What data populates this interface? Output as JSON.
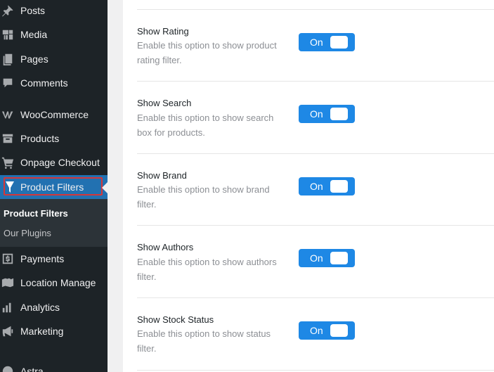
{
  "sidebar": {
    "items": [
      {
        "label": "Posts",
        "icon": "pin-icon"
      },
      {
        "label": "Media",
        "icon": "media-icon"
      },
      {
        "label": "Pages",
        "icon": "pages-icon"
      },
      {
        "label": "Comments",
        "icon": "comment-icon"
      },
      {
        "label": "WooCommerce",
        "icon": "woocommerce-icon"
      },
      {
        "label": "Products",
        "icon": "archive-icon"
      },
      {
        "label": "Onpage Checkout",
        "icon": "cart-icon"
      },
      {
        "label": "Product Filters",
        "icon": "filter-icon"
      },
      {
        "label": "Payments",
        "icon": "dollar-icon"
      },
      {
        "label": "Location Manage",
        "icon": "map-icon"
      },
      {
        "label": "Analytics",
        "icon": "bar-chart-icon"
      },
      {
        "label": "Marketing",
        "icon": "megaphone-icon"
      },
      {
        "label": "Astra",
        "icon": "astra-icon"
      }
    ],
    "submenu": [
      {
        "label": "Product Filters"
      },
      {
        "label": "Our Plugins"
      }
    ]
  },
  "settings": [
    {
      "title": "Show Rating",
      "description": "Enable this option to show product rating filter.",
      "toggle": "On"
    },
    {
      "title": "Show Search",
      "description": "Enable this option to show search box for products.",
      "toggle": "On"
    },
    {
      "title": "Show Brand",
      "description": "Enable this option to show brand filter.",
      "toggle": "On"
    },
    {
      "title": "Show Authors",
      "description": "Enable this option to show authors filter.",
      "toggle": "On"
    },
    {
      "title": "Show Stock Status",
      "description": "Enable this option to show status filter.",
      "toggle": "On"
    }
  ],
  "colors": {
    "sidebar_bg": "#1d2327",
    "active_bg": "#2271b1",
    "highlight_border": "#d63638",
    "toggle_on": "#1e88e5"
  }
}
